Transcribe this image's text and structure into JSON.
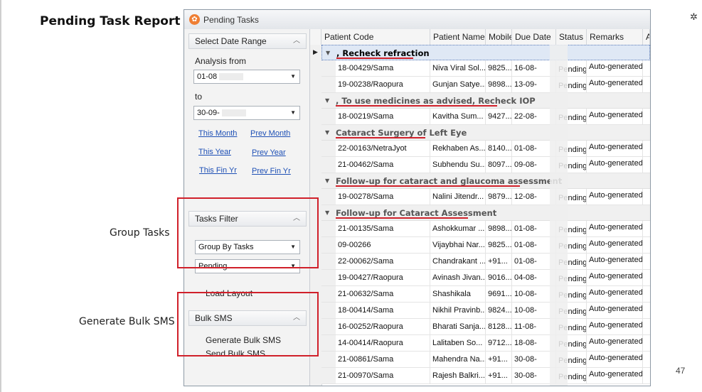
{
  "slide": {
    "title": "Pending Task Report",
    "page_number": "47",
    "annotation_group_tasks": "Group Tasks",
    "annotation_bulk_sms": "Generate Bulk SMS",
    "corner_icon": "gear-icon"
  },
  "window": {
    "title": "Pending Tasks",
    "icon": "app-logo-icon"
  },
  "sidebar": {
    "date_range_header": "Select Date Range",
    "analysis_from_label": "Analysis from",
    "from_date": "01-08",
    "to_label": "to",
    "to_date": "30-09-",
    "links": {
      "this_month": "This Month",
      "prev_month": "Prev Month",
      "this_year": "This Year",
      "prev_year": "Prev Year",
      "this_fin_yr": "This Fin Yr",
      "prev_fin_yr": "Prev Fin Yr"
    },
    "tasks_filter_header": "Tasks Filter",
    "group_by_value": "Group By Tasks",
    "status_value": "Pending",
    "load_layout": "Load Layout",
    "bulk_sms_header": "Bulk SMS",
    "generate_bulk_sms": "Generate Bulk SMS",
    "send_bulk_sms": "Send Bulk SMS"
  },
  "grid": {
    "columns": [
      "Patient Code",
      "Patient Name",
      "Mobile",
      "Due Date",
      "Status",
      "Remarks",
      "A"
    ],
    "groups": [
      {
        "title": ", Recheck refraction",
        "rows": [
          {
            "code": "18-00429/Sama",
            "name": "Niva Viral Sol...",
            "mobile": "9825...",
            "due": "16-08-",
            "status": "Pending",
            "remarks": "Auto-generated"
          },
          {
            "code": "19-00238/Raopura",
            "name": "Gunjan Satye...",
            "mobile": "9898...",
            "due": "13-09-",
            "status": "Pending",
            "remarks": "Auto-generated"
          }
        ]
      },
      {
        "title": ", To use medicines as advised, Recheck IOP",
        "rows": [
          {
            "code": "18-00219/Sama",
            "name": "Kavitha Sum...",
            "mobile": "9427...",
            "due": "22-08-",
            "status": "Pending",
            "remarks": "Auto-generated"
          }
        ]
      },
      {
        "title": "Cataract Surgery of Left Eye",
        "rows": [
          {
            "code": "22-00163/NetraJyot",
            "name": "Rekhaben As...",
            "mobile": "8140...",
            "due": "01-08-",
            "status": "Pending",
            "remarks": "Auto-generated"
          },
          {
            "code": "21-00462/Sama",
            "name": "Subhendu Su...",
            "mobile": "8097...",
            "due": "09-08-",
            "status": "Pending",
            "remarks": "Auto-generated"
          }
        ]
      },
      {
        "title": "Follow-up for cataract and glaucoma assessment",
        "rows": [
          {
            "code": "19-00278/Sama",
            "name": "Nalini Jitendr...",
            "mobile": "9879...",
            "due": "12-08-",
            "status": "Pending",
            "remarks": "Auto-generated"
          }
        ]
      },
      {
        "title": "Follow-up for Cataract Assessment",
        "rows": [
          {
            "code": "21-00135/Sama",
            "name": "Ashokkumar ...",
            "mobile": "9898...",
            "due": "01-08-",
            "status": "Pending",
            "remarks": "Auto-generated"
          },
          {
            "code": "09-00266",
            "name": "Vijaybhai Nar...",
            "mobile": "9825...",
            "due": "01-08-",
            "status": "Pending",
            "remarks": "Auto-generated"
          },
          {
            "code": "22-00062/Sama",
            "name": "Chandrakant ...",
            "mobile": "+91...",
            "due": "01-08-",
            "status": "Pending",
            "remarks": "Auto-generated"
          },
          {
            "code": "19-00427/Raopura",
            "name": "Avinash Jivan...",
            "mobile": "9016...",
            "due": "04-08-",
            "status": "Pending",
            "remarks": "Auto-generated"
          },
          {
            "code": "21-00632/Sama",
            "name": "Shashikala",
            "mobile": "9691...",
            "due": "10-08-",
            "status": "Pending",
            "remarks": "Auto-generated"
          },
          {
            "code": "18-00414/Sama",
            "name": "Nikhil Pravinb...",
            "mobile": "9824...",
            "due": "10-08-",
            "status": "Pending",
            "remarks": "Auto-generated"
          },
          {
            "code": "16-00252/Raopura",
            "name": "Bharati Sanja...",
            "mobile": "8128...",
            "due": "11-08-",
            "status": "Pending",
            "remarks": "Auto-generated"
          },
          {
            "code": "14-00414/Raopura",
            "name": "Lalitaben So...",
            "mobile": "9712...",
            "due": "18-08-",
            "status": "Pending",
            "remarks": "Auto-generated"
          },
          {
            "code": "21-00861/Sama",
            "name": "Mahendra Na...",
            "mobile": "+91...",
            "due": "30-08-",
            "status": "Pending",
            "remarks": "Auto-generated"
          },
          {
            "code": "21-00970/Sama",
            "name": "Rajesh Balkri...",
            "mobile": "+91...",
            "due": "30-08-",
            "status": "Pending",
            "remarks": "Auto-generated"
          }
        ]
      }
    ]
  }
}
